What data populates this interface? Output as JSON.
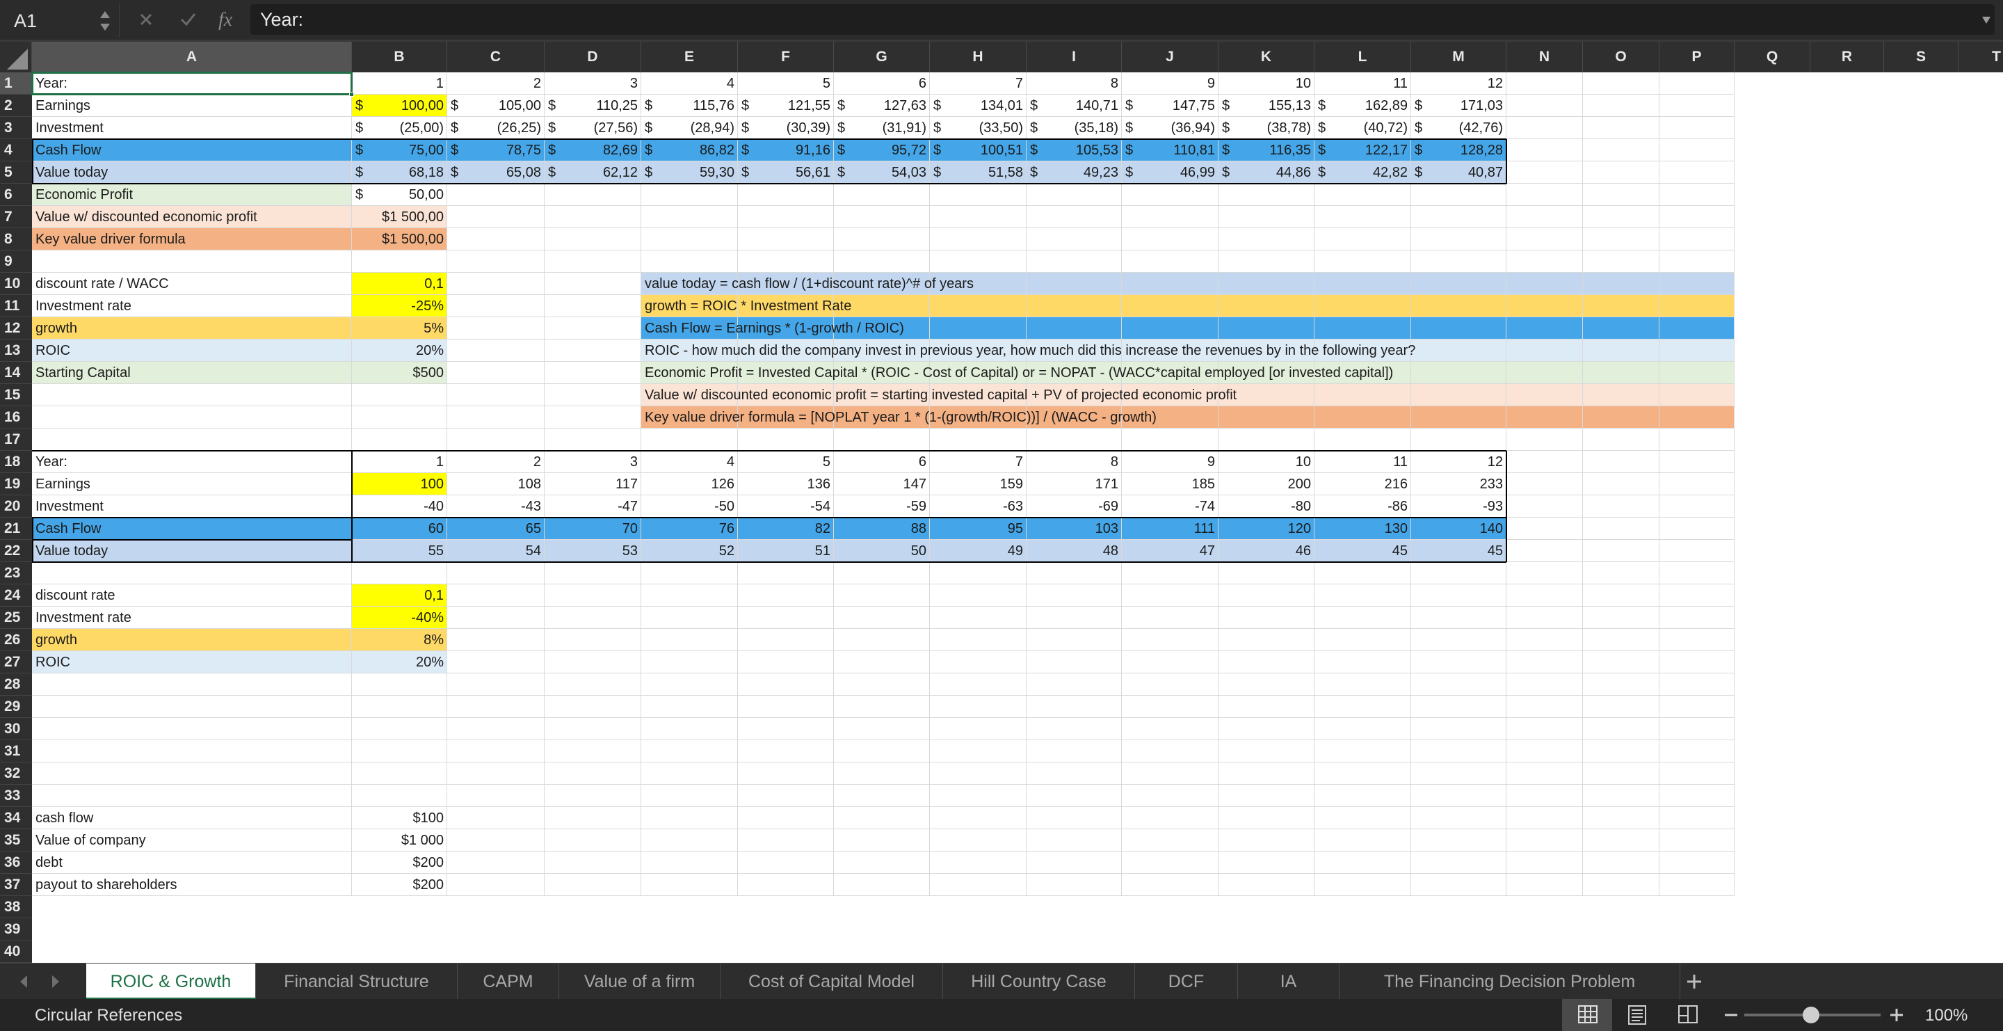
{
  "formula_bar": {
    "name_box": "A1",
    "formula": "Year:"
  },
  "columns": [
    "A",
    "B",
    "C",
    "D",
    "E",
    "F",
    "G",
    "H",
    "I",
    "J",
    "K",
    "L",
    "M",
    "N",
    "O",
    "P",
    "Q",
    "R",
    "S",
    "T"
  ],
  "row_numbers": [
    "1",
    "2",
    "3",
    "4",
    "5",
    "6",
    "7",
    "8",
    "9",
    "10",
    "11",
    "12",
    "13",
    "14",
    "15",
    "16",
    "17",
    "18",
    "19",
    "20",
    "21",
    "22",
    "23",
    "24",
    "25",
    "26",
    "27",
    "28",
    "29",
    "30",
    "31",
    "32",
    "33",
    "34",
    "35",
    "36",
    "37",
    "38",
    "39",
    "40"
  ],
  "colors": {
    "yellow": "#ffff00",
    "blue": "#44a6e8",
    "light_blue": "#c2d7ef",
    "light_green": "#e2efda",
    "peach": "#fbe4d5",
    "orange": "#f4b183",
    "gold": "#ffd966",
    "pale_blue": "#ddebf7",
    "selection_green": "#1e7145"
  },
  "table1": {
    "year_label": "Year:",
    "years": [
      "1",
      "2",
      "3",
      "4",
      "5",
      "6",
      "7",
      "8",
      "9",
      "10",
      "11",
      "12"
    ],
    "earnings_label": "Earnings",
    "earnings": [
      "100,00",
      "105,00",
      "110,25",
      "115,76",
      "121,55",
      "127,63",
      "134,01",
      "140,71",
      "147,75",
      "155,13",
      "162,89",
      "171,03"
    ],
    "investment_label": "Investment",
    "investment": [
      "(25,00)",
      "(26,25)",
      "(27,56)",
      "(28,94)",
      "(30,39)",
      "(31,91)",
      "(33,50)",
      "(35,18)",
      "(36,94)",
      "(38,78)",
      "(40,72)",
      "(42,76)"
    ],
    "cashflow_label": "Cash Flow",
    "cashflow": [
      "75,00",
      "78,75",
      "82,69",
      "86,82",
      "91,16",
      "95,72",
      "100,51",
      "105,53",
      "110,81",
      "116,35",
      "122,17",
      "128,28"
    ],
    "value_today_label": "Value today",
    "value_today": [
      "68,18",
      "65,08",
      "62,12",
      "59,30",
      "56,61",
      "54,03",
      "51,58",
      "49,23",
      "46,99",
      "44,86",
      "42,82",
      "40,87"
    ],
    "currency_symbol": "$",
    "economic_profit_label": "Economic Profit",
    "economic_profit": "50,00",
    "value_discounted_label": "Value w/ discounted economic profit",
    "value_discounted": "$1 500,00",
    "key_value_label": "Key value driver formula",
    "key_value": "$1 500,00"
  },
  "params1": {
    "discount_label": "discount rate / WACC",
    "discount": "0,1",
    "investment_rate_label": "Investment rate",
    "investment_rate": "-25%",
    "growth_label": "growth",
    "growth": "5%",
    "roic_label": "ROIC",
    "roic": "20%",
    "starting_capital_label": "Starting Capital",
    "starting_capital": "$500"
  },
  "notes": {
    "value_today": "value today = cash flow / (1+discount rate)^# of years",
    "growth": "growth = ROIC * Investment Rate",
    "cash_flow": "Cash Flow = Earnings * (1-growth / ROIC)",
    "roic": "ROIC - how much did the company invest in previous year, how much did this increase the revenues by in the following year?",
    "economic_profit": "Economic Profit = Invested Capital * (ROIC - Cost of Capital) or = NOPAT - (WACC*capital employed [or invested capital])",
    "value_discounted": "Value w/ discounted economic profit = starting invested capital + PV of projected economic profit",
    "key_value": "Key value driver formula = [NOPLAT year 1 * (1-(growth/ROIC))] / (WACC - growth)"
  },
  "table2": {
    "year_label": "Year:",
    "years": [
      "1",
      "2",
      "3",
      "4",
      "5",
      "6",
      "7",
      "8",
      "9",
      "10",
      "11",
      "12"
    ],
    "earnings_label": "Earnings",
    "earnings": [
      "100",
      "108",
      "117",
      "126",
      "136",
      "147",
      "159",
      "171",
      "185",
      "200",
      "216",
      "233"
    ],
    "investment_label": "Investment",
    "investment": [
      "-40",
      "-43",
      "-47",
      "-50",
      "-54",
      "-59",
      "-63",
      "-69",
      "-74",
      "-80",
      "-86",
      "-93"
    ],
    "cashflow_label": "Cash Flow",
    "cashflow": [
      "60",
      "65",
      "70",
      "76",
      "82",
      "88",
      "95",
      "103",
      "111",
      "120",
      "130",
      "140"
    ],
    "value_today_label": "Value today",
    "value_today": [
      "55",
      "54",
      "53",
      "52",
      "51",
      "50",
      "49",
      "48",
      "47",
      "46",
      "45",
      "45"
    ]
  },
  "params2": {
    "discount_label": "discount rate",
    "discount": "0,1",
    "investment_rate_label": "Investment rate",
    "investment_rate": "-40%",
    "growth_label": "growth",
    "growth": "8%",
    "roic_label": "ROIC",
    "roic": "20%"
  },
  "table3": {
    "cash_flow_label": "cash flow",
    "cash_flow": "$100",
    "value_label": "Value of company",
    "value": "$1 000",
    "debt_label": "debt",
    "debt": "$200",
    "payout_label": "payout to shareholders",
    "payout": "$200"
  },
  "sheet_tabs": [
    "ROIC & Growth",
    "Financial Structure",
    "CAPM",
    "Value of a firm",
    "Cost of Capital Model",
    "Hill Country Case",
    "DCF",
    "IA",
    "The Financing Decision Problem"
  ],
  "active_tab": "ROIC & Growth",
  "status": {
    "text": "Circular References",
    "zoom": "100%"
  }
}
